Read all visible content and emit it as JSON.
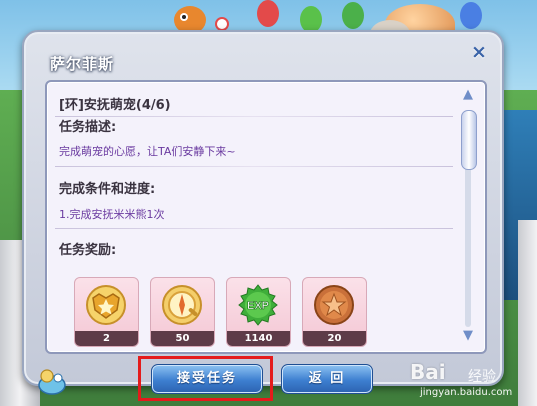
{
  "dialog": {
    "title": "萨尔菲斯",
    "close_symbol": "×"
  },
  "quest": {
    "name": "[环]安抚萌宠(4/6)",
    "description_label": "任务描述:",
    "description_text": "完成萌宠的心愿，让TA们安静下来~",
    "conditions_label": "完成条件和进度:",
    "conditions_text": "1.完成安抚米米熊1次",
    "rewards_label": "任务奖励:"
  },
  "rewards": [
    {
      "icon": "badge-icon",
      "count": "2"
    },
    {
      "icon": "compass-icon",
      "count": "50"
    },
    {
      "icon": "exp-icon",
      "count": "1140",
      "label": "EXP"
    },
    {
      "icon": "star-coin-icon",
      "count": "20"
    }
  ],
  "buttons": {
    "accept": "接受任务",
    "back": "返 回"
  },
  "scrollbar": {
    "up_symbol": "▲",
    "down_symbol": "▼"
  },
  "watermark": {
    "logo": "Bai",
    "text": "经验",
    "url": "jingyan.baidu.com"
  },
  "colors": {
    "highlight_box": "#e41b1b",
    "button_blue": "#3d7fd0",
    "reward_bg": "#f4c7d4",
    "description_text": "#6a3aa0"
  }
}
